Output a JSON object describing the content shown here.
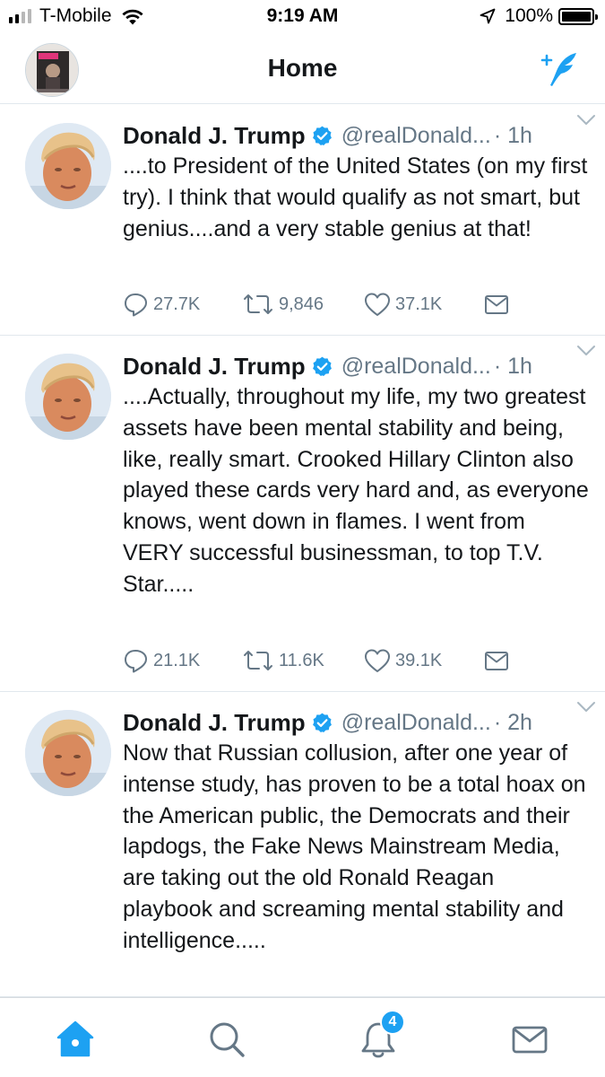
{
  "status_bar": {
    "carrier": "T-Mobile",
    "signal_bars": 4,
    "signal_bars_active": 2,
    "time": "9:19 AM",
    "battery_percent": "100%",
    "battery_level": 1.0
  },
  "header": {
    "title": "Home",
    "compose_icon": "compose-tweet-icon"
  },
  "tweets": [
    {
      "name": "Donald J. Trump",
      "handle": "@realDonald...",
      "time": "· 1h",
      "text": "....to President of the United States (on my first try). I think that would qualify as not smart, but genius....and a very stable genius at that!",
      "replies": "27.7K",
      "retweets": "9,846",
      "likes": "37.1K"
    },
    {
      "name": "Donald J. Trump",
      "handle": "@realDonald...",
      "time": "· 1h",
      "text": "....Actually, throughout my life, my two greatest assets have been mental stability and being, like, really smart. Crooked Hillary Clinton also played these cards very hard and, as everyone knows, went down in flames. I went from VERY successful businessman, to top T.V. Star.....",
      "replies": "21.1K",
      "retweets": "11.6K",
      "likes": "39.1K"
    },
    {
      "name": "Donald J. Trump",
      "handle": "@realDonald...",
      "time": "· 2h",
      "text": "Now that Russian collusion, after one year of intense study, has proven to be a total hoax on the American public, the Democrats and their lapdogs, the Fake News Mainstream Media, are taking out the old Ronald Reagan playbook and screaming mental stability and intelligence....."
    }
  ],
  "tab_bar": {
    "notification_badge": "4",
    "tabs": [
      "home-tab-icon",
      "search-tab-icon",
      "notifications-tab-icon",
      "messages-tab-icon"
    ]
  },
  "colors": {
    "accent": "#1da1f2",
    "text_primary": "#14171a",
    "text_secondary": "#657786",
    "divider": "#e1e8ed"
  }
}
